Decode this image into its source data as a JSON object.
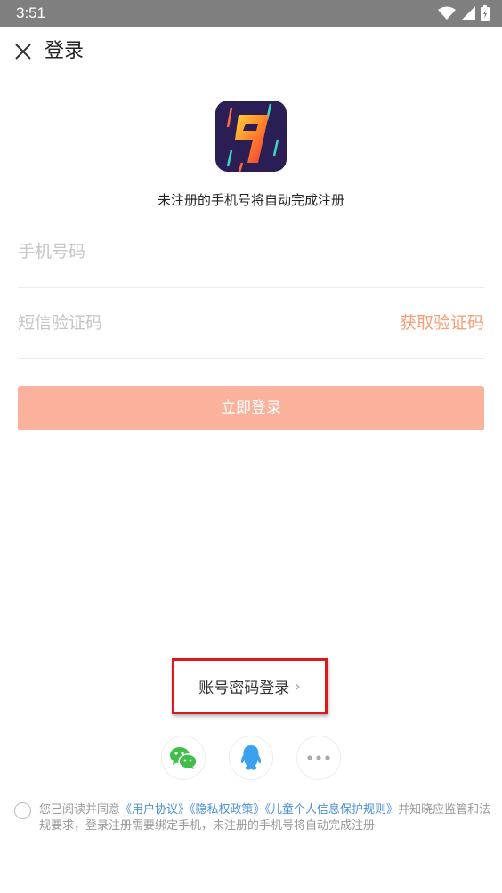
{
  "status_bar": {
    "time": "3:51"
  },
  "header": {
    "title": "登录"
  },
  "subtitle": "未注册的手机号将自动完成注册",
  "form": {
    "phone_placeholder": "手机号码",
    "sms_placeholder": "短信验证码",
    "get_code_label": "获取验证码",
    "login_label": "立即登录"
  },
  "alt_login": {
    "account_password_label": "账号密码登录"
  },
  "agreement": {
    "prefix": "您已阅读并同意",
    "user_agreement": "《用户协议》",
    "privacy_policy": "《隐私权政策》",
    "child_policy": "《儿童个人信息保护规则》",
    "suffix": "并知晓应监管和法规要求，登录注册需要绑定手机，未注册的手机号将自动完成注册"
  },
  "colors": {
    "accent": "#f7a078",
    "button": "#fbb29d",
    "link": "#4a8fd9",
    "wechat": "#3fbf4a",
    "qq": "#3aa0f0",
    "logo_bg": "#2a1e55"
  },
  "icons": [
    "wifi-icon",
    "signal-icon",
    "battery-icon",
    "close-icon",
    "app-logo",
    "wechat-icon",
    "qq-icon",
    "more-icon"
  ]
}
